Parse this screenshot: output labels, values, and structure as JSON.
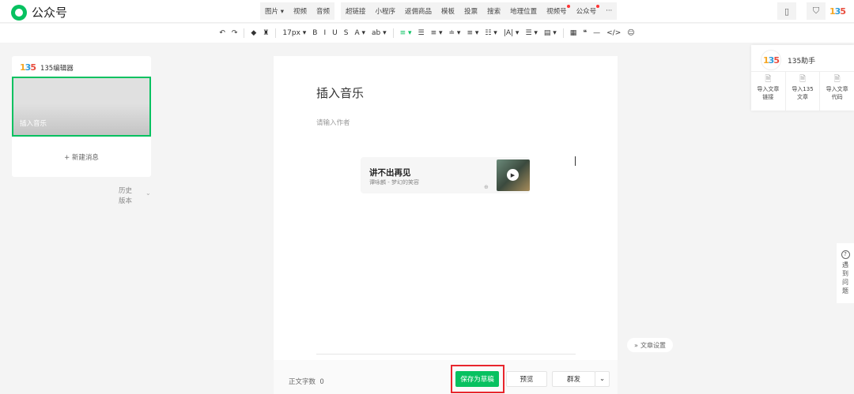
{
  "app": {
    "title": "公众号"
  },
  "insert_group_1": [
    "图片 ▾",
    "视频",
    "音频"
  ],
  "insert_group_2": [
    "超链接",
    "小程序",
    "返佣商品",
    "模板",
    "投票",
    "搜索",
    "地理位置",
    "视频号",
    "公众号",
    "···"
  ],
  "badged": [
    "视频号",
    "公众号"
  ],
  "toolbar": [
    "↶",
    "↷",
    "|",
    "◆",
    "♜",
    "|",
    "17px ▾",
    "B",
    "I",
    "U",
    "S",
    "A ▾",
    "ab ▾",
    "|",
    "≡ ▾",
    "☰",
    "≡ ▾",
    "≐ ▾",
    "≡ ▾",
    "☷ ▾",
    "|A| ▾",
    "☰ ▾",
    "▤ ▾",
    "|",
    "▦",
    "❝",
    "—",
    "</>",
    "☺"
  ],
  "left": {
    "brand": "135编辑器",
    "article_title": "插入音乐",
    "new_message": "+ 新建消息",
    "history": "历史版本"
  },
  "editor": {
    "title": "插入音乐",
    "author_placeholder": "请输入作者",
    "music": {
      "song": "讲不出再见",
      "artist": "谭咏麟 - 梦幻的笑容"
    },
    "word_count_label": "正文字数",
    "word_count": "0"
  },
  "footer": {
    "save": "保存为草稿",
    "preview": "预览",
    "publish": "群发"
  },
  "settings": "文章设置",
  "helper": {
    "title": "135助手",
    "items": [
      [
        "导入文章",
        "链接"
      ],
      [
        "导入135",
        "文章"
      ],
      [
        "导入文章",
        "代码"
      ]
    ]
  },
  "help": {
    "text": "遇到问题"
  },
  "colors": {
    "brand": "#07c160",
    "highlight": "#e8262d"
  }
}
